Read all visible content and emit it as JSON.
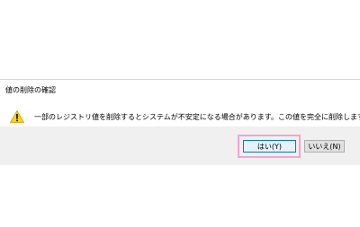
{
  "dialog": {
    "title": "値の削除の確認",
    "icon": "warning-icon",
    "message": "一部のレジストリ値を削除するとシステムが不安定になる場合があります。この値を完全に削除しますか?",
    "buttons": {
      "yes_label": "はい(Y)",
      "no_label": "いいえ(N)"
    },
    "highlight_color": "#f3a5cf",
    "default_button_color": "#0078d7"
  }
}
